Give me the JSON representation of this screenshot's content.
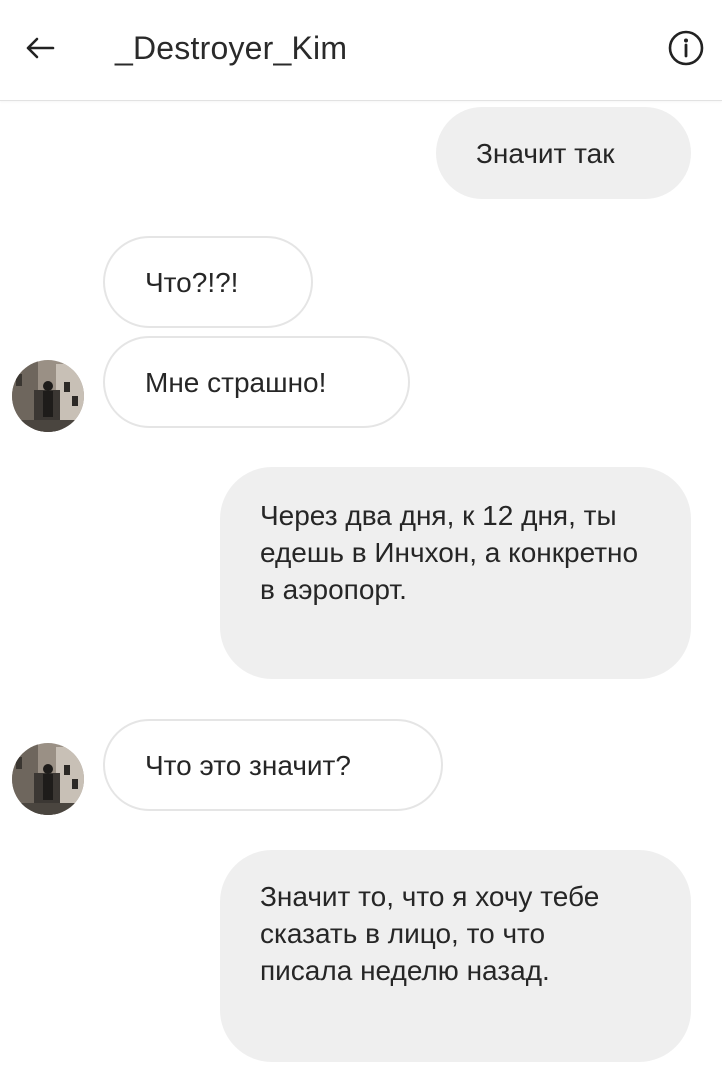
{
  "header": {
    "back_icon": "arrow-left-icon",
    "title": "_Destroyer_Kim",
    "info_icon": "info-circle-icon"
  },
  "messages": [
    {
      "direction": "outgoing",
      "text": "Значит так"
    },
    {
      "direction": "incoming",
      "text": "Что?!?!"
    },
    {
      "direction": "incoming",
      "text": "Мне страшно!",
      "avatar": true
    },
    {
      "direction": "outgoing",
      "text": "Через два дня, к 12 дня, ты едешь в Инчхон, а конкретно в аэропорт."
    },
    {
      "direction": "incoming",
      "text": "Что это значит?",
      "avatar": true
    },
    {
      "direction": "outgoing",
      "text": "Значит то, что я хочу тебе сказать в лицо, то что писала неделю назад."
    }
  ],
  "colors": {
    "outgoing_bubble": "#efefef",
    "incoming_border": "#e5e5e5",
    "text": "#262626"
  }
}
